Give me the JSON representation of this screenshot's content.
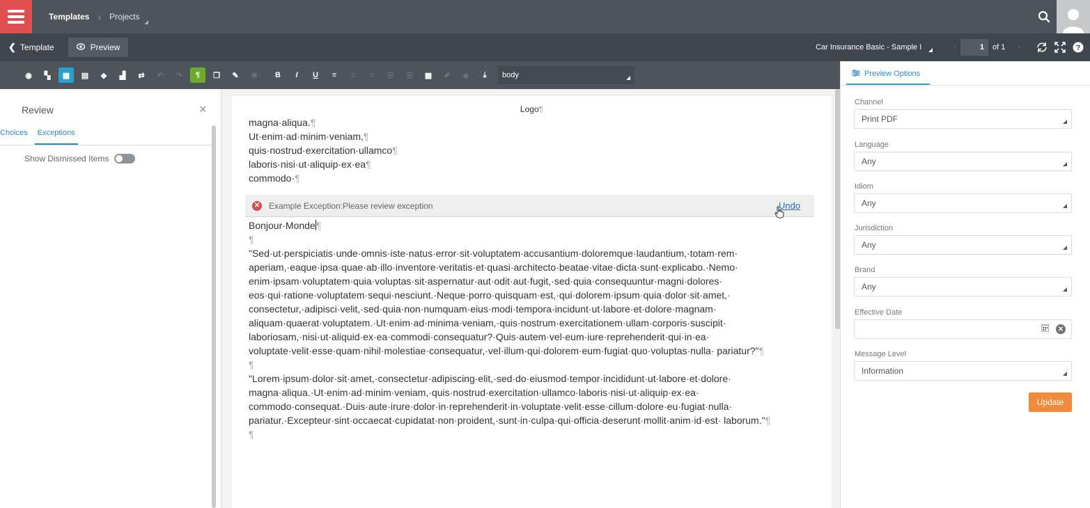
{
  "topbar": {
    "breadcrumb": [
      "Templates",
      "Projects"
    ],
    "icons": [
      "menu-icon",
      "search-icon",
      "avatar"
    ]
  },
  "navbar": {
    "back_label": "Template",
    "preview_label": "Preview",
    "document_select": "Car Insurance Basic - Sample I",
    "page_current": "1",
    "page_total": "of 1",
    "icons": [
      "refresh-icon",
      "fullscreen-icon",
      "help-icon"
    ]
  },
  "toolbar": {
    "style_select": "body",
    "buttons": [
      {
        "name": "eye-icon",
        "glyph": "◉"
      },
      {
        "name": "map-icon",
        "glyph": "▚"
      },
      {
        "name": "table-icon",
        "glyph": "▦"
      },
      {
        "name": "database-icon",
        "glyph": "▤"
      },
      {
        "name": "layers-icon",
        "glyph": "◆"
      },
      {
        "name": "binoculars-icon",
        "glyph": "▟"
      },
      {
        "name": "transfer-icon",
        "glyph": "⇄"
      },
      {
        "name": "undo-icon",
        "glyph": "↶"
      },
      {
        "name": "redo-icon",
        "glyph": "↷"
      },
      {
        "name": "pilcrow-icon",
        "glyph": "¶"
      },
      {
        "name": "copy-icon",
        "glyph": "❐"
      },
      {
        "name": "edit-icon",
        "glyph": "✎"
      },
      {
        "name": "star-icon",
        "glyph": "✱"
      },
      {
        "name": "bold-icon",
        "glyph": "B"
      },
      {
        "name": "italic-icon",
        "glyph": "I"
      },
      {
        "name": "underline-icon",
        "glyph": "U"
      },
      {
        "name": "align-left-icon",
        "glyph": "≡"
      },
      {
        "name": "align-center-icon",
        "glyph": "≡"
      },
      {
        "name": "align-right-icon",
        "glyph": "≡"
      },
      {
        "name": "list-icon",
        "glyph": "☰"
      },
      {
        "name": "numbered-list-icon",
        "glyph": "☰"
      },
      {
        "name": "grid-icon",
        "glyph": "▦"
      },
      {
        "name": "pen-icon",
        "glyph": "✐"
      },
      {
        "name": "fill-icon",
        "glyph": "◈"
      },
      {
        "name": "import-icon",
        "glyph": "⤓"
      }
    ]
  },
  "review": {
    "title": "Review",
    "tabs": [
      "Choices",
      "Exceptions"
    ],
    "active_tab": "Exceptions",
    "show_dismissed_label": "Show Dismissed Items",
    "show_dismissed": false
  },
  "editor": {
    "logo": "Logo",
    "lines": [
      "magna·aliqua.",
      "Ut·enim·ad·minim·veniam,",
      "quis·nostrud·exercitation·ullamco",
      "laboris·nisi·ut·aliquip·ex·ea",
      "commodo·"
    ],
    "exception_text": "Example Exception:Please review exception",
    "undo_label": "Undo",
    "heading_line": "Bonjour·Monde",
    "paragraph1": "\"Sed·ut·perspiciatis·unde·omnis·iste·natus·error·sit·voluptatem·accusantium·doloremque·laudantium,·totam·rem· aperiam,·eaque·ipsa·quae·ab·illo·inventore·veritatis·et·quasi·architecto·beatae·vitae·dicta·sunt·explicabo.·Nemo· enim·ipsam·voluptatem·quia·voluptas·sit·aspernatur·aut·odit·aut·fugit,·sed·quia·consequuntur·magni·dolores· eos·qui·ratione·voluptatem·sequi·nesciunt.·Neque·porro·quisquam·est,·qui·dolorem·ipsum·quia·dolor·sit·amet,· consectetur,·adipisci·velit,·sed·quia·non·numquam·eius·modi·tempora·incidunt·ut·labore·et·dolore·magnam· aliquam·quaerat·voluptatem.·Ut·enim·ad·minima·veniam,·quis·nostrum·exercitationem·ullam·corporis·suscipit· laboriosam,·nisi·ut·aliquid·ex·ea·commodi·consequatur?·Quis·autem·vel·eum·iure·reprehenderit·qui·in·ea· voluptate·velit·esse·quam·nihil·molestiae·consequatur,·vel·illum·qui·dolorem·eum·fugiat·quo·voluptas·nulla· pariatur?\"",
    "paragraph2": "\"Lorem·ipsum·dolor·sit·amet,·consectetur·adipiscing·elit,·sed·do·eiusmod·tempor·incididunt·ut·labore·et·dolore· magna·aliqua.·Ut·enim·ad·minim·veniam,·quis·nostrud·exercitation·ullamco·laboris·nisi·ut·aliquip·ex·ea· commodo·consequat.·Duis·aute·irure·dolor·in·reprehenderit·in·voluptate·velit·esse·cillum·dolore·eu·fugiat·nulla· pariatur.·Excepteur·sint·occaecat·cupidatat·non·proident,·sunt·in·culpa·qui·officia·deserunt·mollit·anim·id·est· laborum.\"",
    "pilcrow": "¶"
  },
  "preview_options": {
    "tab_label": "Preview Options",
    "fields": [
      {
        "label": "Channel",
        "value": "Print PDF"
      },
      {
        "label": "Language",
        "value": "Any"
      },
      {
        "label": "Idiom",
        "value": "Any"
      },
      {
        "label": "Jurisdiction",
        "value": "Any"
      },
      {
        "label": "Brand",
        "value": "Any"
      },
      {
        "label": "Effective Date",
        "value": ""
      },
      {
        "label": "Message Level",
        "value": "Information"
      }
    ],
    "update_label": "Update"
  },
  "colors": {
    "topbar": "#4d545a",
    "menu_button": "#e04f4f",
    "accent_blue": "#2b9fcf",
    "active_green": "#6aab2a",
    "update_orange": "#f08a3c",
    "error_red": "#d84a4a"
  }
}
